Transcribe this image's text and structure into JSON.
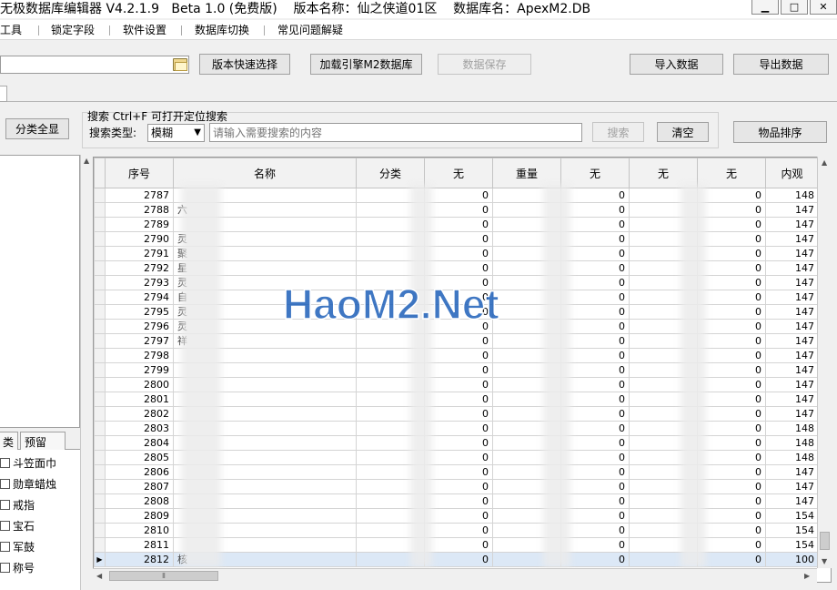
{
  "window": {
    "title": "无极数据库编辑器 V4.2.1.9   Beta 1.0 (免费版)    版本名称：仙之侠道01区    数据库名：ApexM2.DB",
    "controls": [
      "minimize-icon",
      "maximize-icon",
      "close-icon"
    ]
  },
  "menu": {
    "items": [
      "工具",
      "锁定字段",
      "软件设置",
      "数据库切换",
      "常见问题解疑"
    ]
  },
  "toolbar": {
    "path_value": "",
    "quick_select_label": "版本快速选择",
    "load_m2_label": "加载引擎M2数据库",
    "save_label": "数据保存",
    "import_label": "导入数据",
    "export_label": "导出数据"
  },
  "filter": {
    "all_categories_label": "分类全显",
    "search_title": "搜索  Ctrl+F 可打开定位搜索",
    "search_type_label": "搜索类型:",
    "search_type_value": "模糊",
    "search_placeholder": "请输入需要搜索的内容",
    "search_button": "搜索",
    "clear_button": "清空",
    "sort_button": "物品排序"
  },
  "left": {
    "tabs": [
      "类",
      "预留"
    ],
    "categories": [
      "斗笠面巾",
      "勋章蜡烛",
      "戒指",
      "宝石",
      "军鼓",
      "称号"
    ]
  },
  "grid": {
    "columns": [
      "序号",
      "名称",
      "分类",
      "无",
      "重量",
      "无",
      "无",
      "无",
      "内观"
    ],
    "rows": [
      [
        "2787",
        "",
        "",
        "0",
        "",
        "0",
        "",
        "0",
        "148"
      ],
      [
        "2788",
        "六",
        "",
        "0",
        "",
        "0",
        "",
        "0",
        "147"
      ],
      [
        "2789",
        "",
        "",
        "0",
        "",
        "0",
        "",
        "0",
        "147"
      ],
      [
        "2790",
        "灵",
        "",
        "0",
        "",
        "0",
        "",
        "0",
        "147"
      ],
      [
        "2791",
        "聚",
        "",
        "0",
        "",
        "0",
        "",
        "0",
        "147"
      ],
      [
        "2792",
        "星",
        "",
        "0",
        "",
        "0",
        "",
        "0",
        "147"
      ],
      [
        "2793",
        "灵",
        "",
        "0",
        "",
        "0",
        "",
        "0",
        "147"
      ],
      [
        "2794",
        "自",
        "",
        "0",
        "",
        "0",
        "",
        "0",
        "147"
      ],
      [
        "2795",
        "灵",
        "",
        "0",
        "",
        "0",
        "",
        "0",
        "147"
      ],
      [
        "2796",
        "灵",
        "",
        "0",
        "",
        "0",
        "",
        "0",
        "147"
      ],
      [
        "2797",
        "祥",
        "",
        "0",
        "",
        "0",
        "",
        "0",
        "147"
      ],
      [
        "2798",
        "",
        "",
        "0",
        "",
        "0",
        "",
        "0",
        "147"
      ],
      [
        "2799",
        "",
        "",
        "0",
        "",
        "0",
        "",
        "0",
        "147"
      ],
      [
        "2800",
        "",
        "",
        "0",
        "",
        "0",
        "",
        "0",
        "147"
      ],
      [
        "2801",
        "",
        "",
        "0",
        "",
        "0",
        "",
        "0",
        "147"
      ],
      [
        "2802",
        "",
        "",
        "0",
        "",
        "0",
        "",
        "0",
        "147"
      ],
      [
        "2803",
        "",
        "",
        "0",
        "",
        "0",
        "",
        "0",
        "148"
      ],
      [
        "2804",
        "",
        "",
        "0",
        "",
        "0",
        "",
        "0",
        "148"
      ],
      [
        "2805",
        "",
        "",
        "0",
        "",
        "0",
        "",
        "0",
        "148"
      ],
      [
        "2806",
        "",
        "",
        "0",
        "",
        "0",
        "",
        "0",
        "147"
      ],
      [
        "2807",
        "",
        "",
        "0",
        "",
        "0",
        "",
        "0",
        "147"
      ],
      [
        "2808",
        "",
        "",
        "0",
        "",
        "0",
        "",
        "0",
        "147"
      ],
      [
        "2809",
        "",
        "",
        "0",
        "",
        "0",
        "",
        "0",
        "154"
      ],
      [
        "2810",
        "",
        "",
        "0",
        "",
        "0",
        "",
        "0",
        "154"
      ],
      [
        "2811",
        "",
        "",
        "0",
        "",
        "0",
        "",
        "0",
        "154"
      ],
      [
        "2812",
        "核",
        "",
        "0",
        "",
        "0",
        "",
        "0",
        "100"
      ]
    ],
    "current_row_index": 25
  },
  "watermark_text": "HaoM2.Net"
}
